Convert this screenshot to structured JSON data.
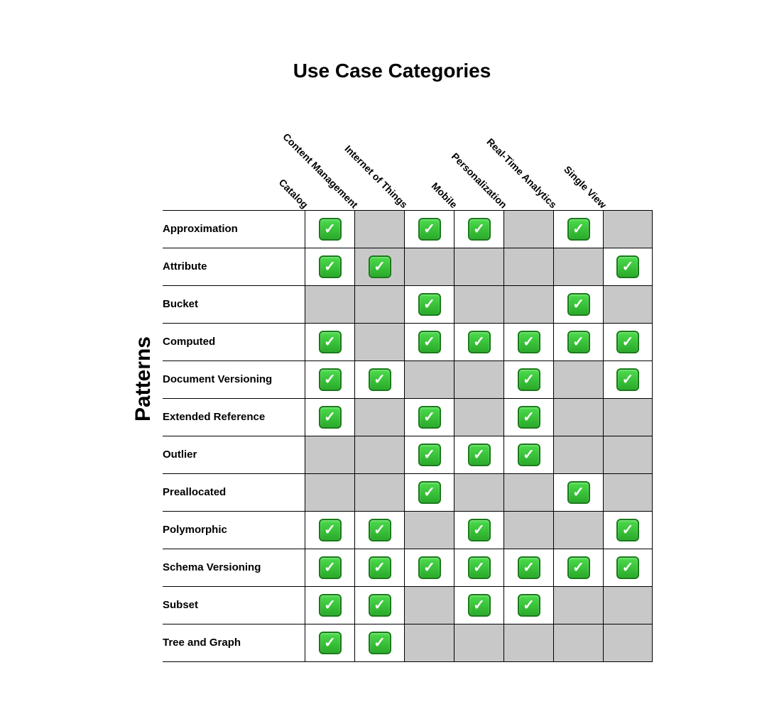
{
  "title": "Use Case Categories",
  "vertical_label": "Patterns",
  "columns": [
    "Catalog",
    "Content Management",
    "Internet of Things",
    "Mobile",
    "Personalization",
    "Real-Time Analytics",
    "Single View"
  ],
  "rows": [
    {
      "label": "Approximation",
      "cells": [
        true,
        false,
        true,
        true,
        false,
        true,
        false
      ]
    },
    {
      "label": "Attribute",
      "cells": [
        true,
        true,
        false,
        false,
        false,
        false,
        true
      ]
    },
    {
      "label": "Bucket",
      "cells": [
        false,
        false,
        true,
        false,
        false,
        true,
        false
      ]
    },
    {
      "label": "Computed",
      "cells": [
        true,
        false,
        true,
        true,
        true,
        true,
        true
      ]
    },
    {
      "label": "Document Versioning",
      "cells": [
        true,
        true,
        false,
        false,
        true,
        false,
        true
      ]
    },
    {
      "label": "Extended Reference",
      "cells": [
        true,
        false,
        true,
        false,
        true,
        false,
        false
      ]
    },
    {
      "label": "Outlier",
      "cells": [
        false,
        false,
        true,
        true,
        true,
        false,
        false
      ]
    },
    {
      "label": "Preallocated",
      "cells": [
        false,
        false,
        true,
        false,
        false,
        true,
        false
      ]
    },
    {
      "label": "Polymorphic",
      "cells": [
        true,
        true,
        false,
        true,
        false,
        false,
        true
      ]
    },
    {
      "label": "Schema Versioning",
      "cells": [
        true,
        true,
        true,
        true,
        true,
        true,
        true
      ]
    },
    {
      "label": "Subset",
      "cells": [
        true,
        true,
        false,
        true,
        true,
        false,
        false
      ]
    },
    {
      "label": "Tree and Graph",
      "cells": [
        true,
        true,
        false,
        false,
        false,
        false,
        false
      ]
    }
  ],
  "col_gray_pattern": [
    [
      false,
      true,
      false,
      false,
      true,
      false,
      true
    ],
    [
      false,
      true,
      true,
      true,
      true,
      true,
      false
    ],
    [
      true,
      true,
      false,
      true,
      true,
      false,
      true
    ],
    [
      false,
      true,
      false,
      false,
      false,
      false,
      false
    ],
    [
      false,
      false,
      true,
      true,
      false,
      true,
      false
    ],
    [
      false,
      true,
      false,
      true,
      false,
      true,
      true
    ],
    [
      true,
      true,
      false,
      false,
      false,
      true,
      true
    ],
    [
      true,
      true,
      false,
      true,
      true,
      false,
      true
    ],
    [
      false,
      false,
      true,
      false,
      true,
      true,
      false
    ],
    [
      false,
      false,
      false,
      false,
      false,
      false,
      false
    ],
    [
      false,
      false,
      true,
      false,
      false,
      true,
      true
    ],
    [
      false,
      false,
      true,
      true,
      true,
      true,
      true
    ]
  ]
}
